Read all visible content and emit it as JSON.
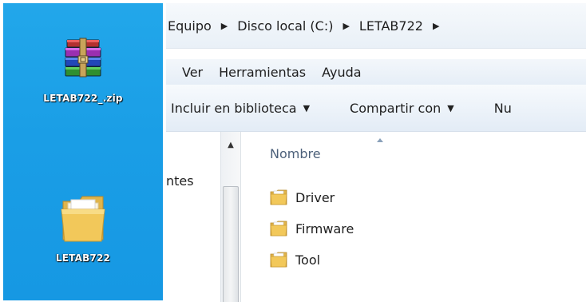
{
  "desktop": {
    "icons": [
      {
        "label": "LETAB722_.zip",
        "icon": "winrar-archive-icon"
      },
      {
        "label": "LETAB722",
        "icon": "folder-icon"
      }
    ]
  },
  "explorer": {
    "breadcrumb": [
      "Equipo",
      "Disco local (C:)",
      "LETAB722"
    ],
    "menu": [
      "Ver",
      "Herramientas",
      "Ayuda"
    ],
    "toolbar": [
      "Incluir en biblioteca",
      "Compartir con",
      "Nu"
    ],
    "nav_partial": "ntes",
    "column_header": "Nombre",
    "files": [
      {
        "name": "Driver",
        "icon": "folder-icon"
      },
      {
        "name": "Firmware",
        "icon": "folder-icon"
      },
      {
        "name": "Tool",
        "icon": "folder-icon"
      }
    ]
  },
  "colors": {
    "desktop_bg": "#1a9ee6",
    "header_text": "#4c607a",
    "folder_yellow": "#f2c85a"
  }
}
